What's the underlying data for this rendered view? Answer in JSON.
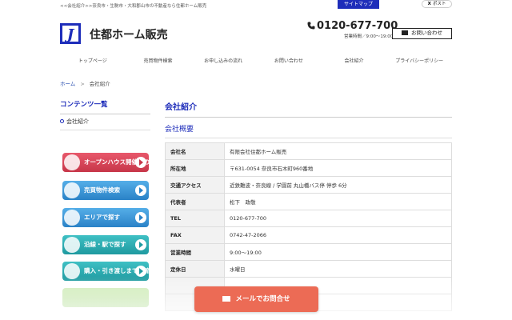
{
  "topbar": {
    "crumb": "<<会社紹介>>奈良市・生駒市・大和郡山市の不動産なら住都ホーム販売",
    "sitemap": "サイトマップ",
    "post": "ポスト",
    "post_icon": "X"
  },
  "header": {
    "logo_text": "J",
    "brand": "住都ホーム販売",
    "phone": "0120-677-700",
    "hours": "営業時間／9:00～19:00",
    "contact_label": "お問い合わせ"
  },
  "nav": [
    "トップページ",
    "売買物件検索",
    "お申し込みの流れ",
    "お問い合わせ",
    "会社紹介",
    "プライバシーポリシー"
  ],
  "breadcrumb": {
    "home": "ホーム",
    "sep": ">",
    "current": "会社紹介"
  },
  "sidebar": {
    "title": "コンテンツ一覧",
    "link": "会社紹介",
    "banners": [
      "オープンハウス開催中の物件",
      "売買物件検索",
      "エリアで探す",
      "沿線・駅で探す",
      "購入・引き渡しまでの流れ"
    ]
  },
  "main": {
    "title": "会社紹介",
    "section": "会社概要",
    "rows": [
      {
        "k": "会社名",
        "v": "有限会社住都ホーム販売"
      },
      {
        "k": "所在地",
        "v": "〒631-0054 奈良市石木町960番地"
      },
      {
        "k": "交通アクセス",
        "v": "近鉄難波・奈良線 / 学園前 丸山橋バス停 停歩 6分"
      },
      {
        "k": "代表者",
        "v": "松下　政敬"
      },
      {
        "k": "TEL",
        "v": "0120-677-700"
      },
      {
        "k": "FAX",
        "v": "0742-47-2066"
      },
      {
        "k": "営業時間",
        "v": "9:00～19:00"
      },
      {
        "k": "定休日",
        "v": "水曜日"
      }
    ]
  },
  "cta": {
    "label": "メールでお問合せ"
  },
  "colors": {
    "accent": "#1e2dba",
    "cta": "#ec6b55"
  }
}
